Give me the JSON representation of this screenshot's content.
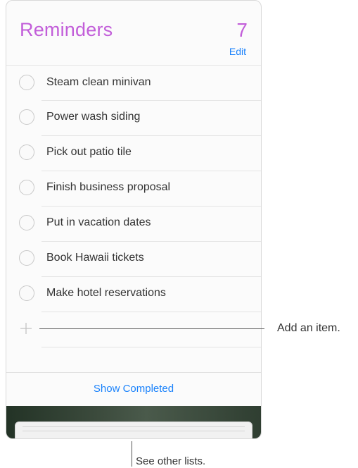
{
  "header": {
    "title": "Reminders",
    "count": "7",
    "edit_label": "Edit"
  },
  "reminders": [
    {
      "label": "Steam clean minivan",
      "completed": false
    },
    {
      "label": "Power wash siding",
      "completed": false
    },
    {
      "label": "Pick out patio tile",
      "completed": false
    },
    {
      "label": "Finish business proposal",
      "completed": false
    },
    {
      "label": "Put in vacation dates",
      "completed": false
    },
    {
      "label": "Book Hawaii tickets",
      "completed": false
    },
    {
      "label": "Make hotel reservations",
      "completed": false
    }
  ],
  "add_item": {
    "icon": "plus-icon"
  },
  "footer": {
    "show_completed_label": "Show Completed"
  },
  "callouts": {
    "add_item": "Add an item.",
    "other_lists": "See other lists."
  },
  "colors": {
    "accent_purple": "#c25ed9",
    "link_blue": "#1a82fb"
  }
}
